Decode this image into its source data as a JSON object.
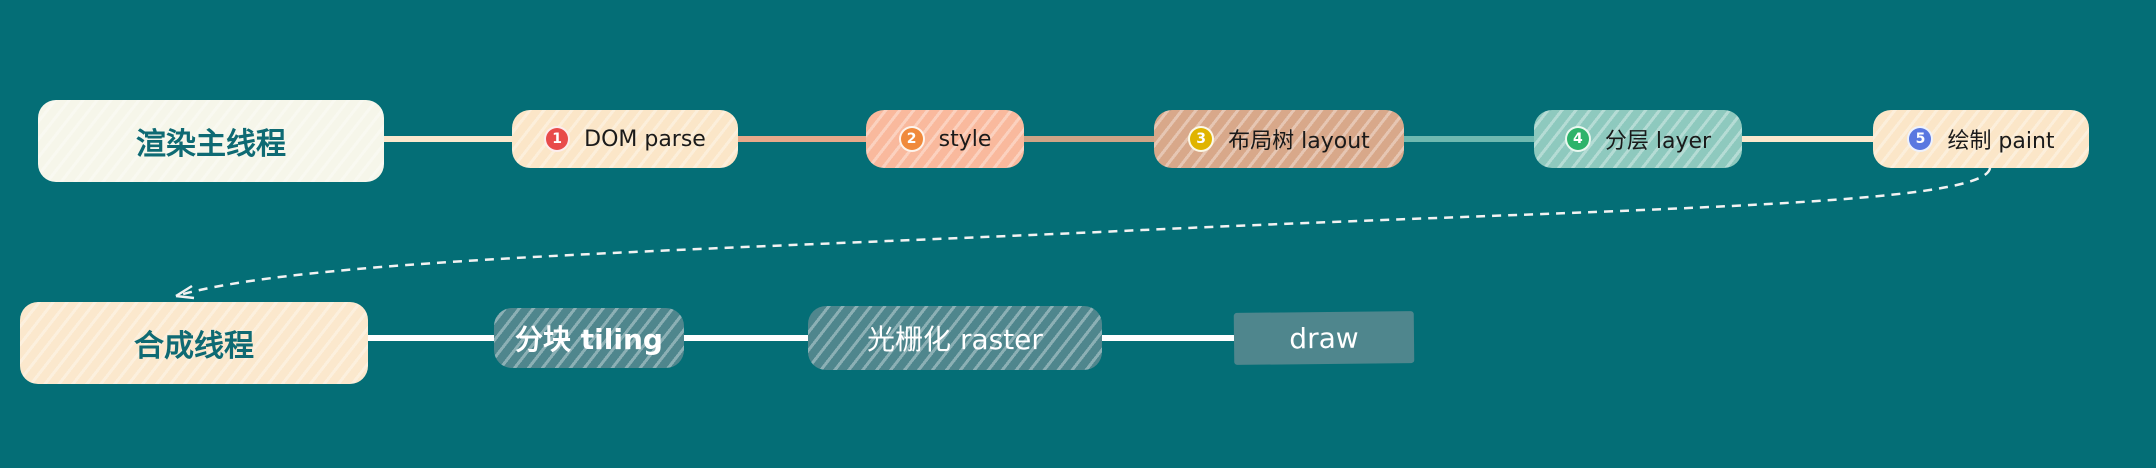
{
  "main_thread": {
    "title": "渲染主线程",
    "steps": [
      {
        "badge": "1",
        "label": "DOM parse",
        "badge_color": "#e84a4a",
        "fill": "#fbe6c8"
      },
      {
        "badge": "2",
        "label": "style",
        "badge_color": "#f08a3c",
        "fill": "#f9b99d"
      },
      {
        "badge": "3",
        "label": "布局树 layout",
        "badge_color": "#e0b400",
        "fill": "#d8a88a"
      },
      {
        "badge": "4",
        "label": "分层 layer",
        "badge_color": "#2db36a",
        "fill": "#8ec9be"
      },
      {
        "badge": "5",
        "label": "绘制 paint",
        "badge_color": "#5a78e0",
        "fill": "#fbe6c8"
      }
    ]
  },
  "compositor_thread": {
    "title": "合成线程",
    "steps": [
      {
        "label": "分块 tiling"
      },
      {
        "label": "光栅化 raster"
      },
      {
        "label": "draw"
      }
    ]
  },
  "colors": {
    "background": "#046e76",
    "thread_box": "#f6f6ea",
    "compositor_box": "#fbe8cd",
    "dark_step": "#4f868d",
    "connector_light": "#fbe8cd",
    "connector_salmon": "#e8a98a",
    "connector_tan": "#cfa486",
    "connector_teal": "#6fb9b0"
  }
}
